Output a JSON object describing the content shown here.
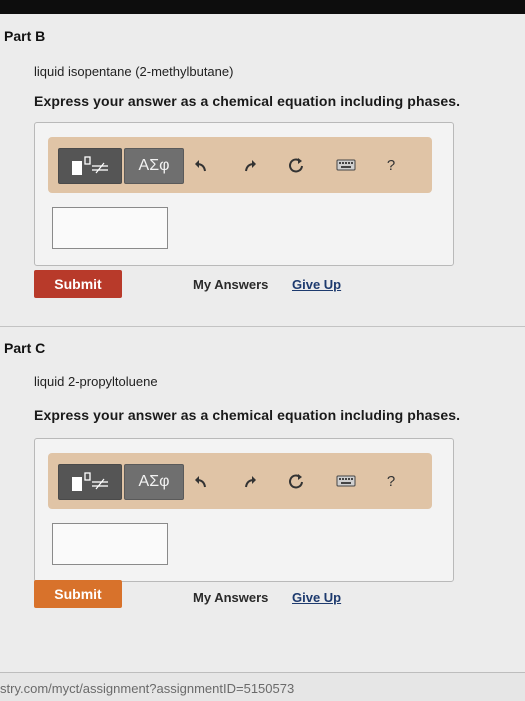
{
  "parts": [
    {
      "title": "Part B",
      "question": "liquid isopentane (2-methylbutane)",
      "instruction": "Express your answer as a chemical equation including phases.",
      "submit_label": "Submit",
      "submit_color": "#b83a2a",
      "my_answers_label": "My Answers",
      "give_up_label": "Give Up"
    },
    {
      "title": "Part C",
      "question": "liquid 2-propyltoluene",
      "instruction": "Express your answer as a chemical equation including phases.",
      "submit_label": "Submit",
      "submit_color": "#d8722b",
      "my_answers_label": "My Answers",
      "give_up_label": "Give Up"
    }
  ],
  "toolbar": {
    "greek_label": "ΑΣφ",
    "help_label": "?",
    "icons": [
      "templates-icon",
      "undo-icon",
      "redo-icon",
      "reset-icon",
      "keyboard-icon",
      "help-icon"
    ]
  },
  "url": "stry.com/myct/assignment?assignmentID=5150573"
}
